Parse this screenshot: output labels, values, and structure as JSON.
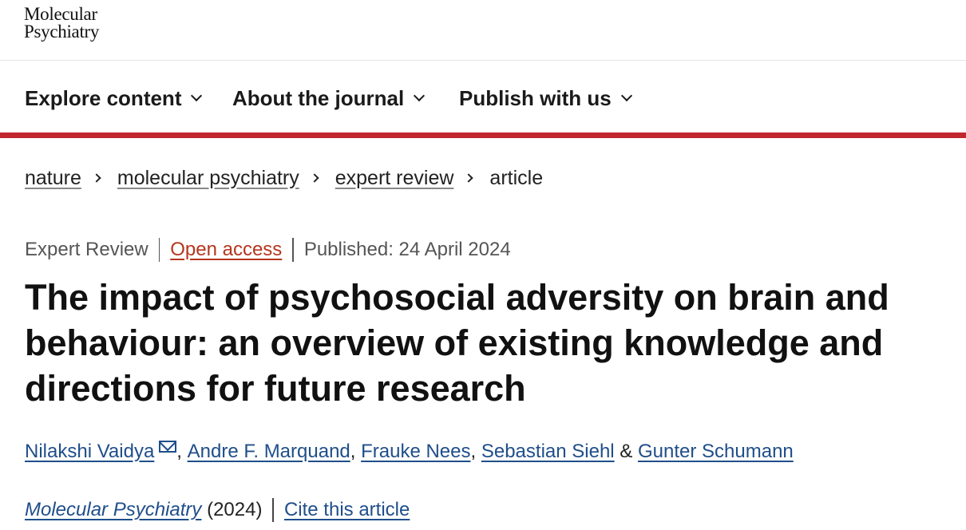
{
  "logo": {
    "line1": "Molecular",
    "line2": "Psychiatry"
  },
  "nav": {
    "items": [
      {
        "label": "Explore content"
      },
      {
        "label": "About the journal"
      },
      {
        "label": "Publish with us"
      }
    ]
  },
  "breadcrumb": {
    "items": [
      "nature",
      "molecular psychiatry",
      "expert review",
      "article"
    ]
  },
  "meta": {
    "type": "Expert Review",
    "access": "Open access",
    "published": "Published: 24 April 2024"
  },
  "article": {
    "title": "The impact of psychosocial adversity on brain and behaviour: an overview of existing knowledge and directions for future research"
  },
  "authors": {
    "list": [
      "Nilakshi Vaidya",
      "Andre F. Marquand",
      "Frauke Nees",
      "Sebastian Siehl",
      "Gunter Schumann"
    ],
    "sep_comma": ",",
    "sep_amp": "&"
  },
  "citation": {
    "journal": "Molecular Psychiatry",
    "year": "(2024)",
    "cite_label": "Cite this article"
  },
  "colors": {
    "accent_bar": "#c1272d",
    "link": "#1f4e8a",
    "open_access": "#b5361d"
  }
}
